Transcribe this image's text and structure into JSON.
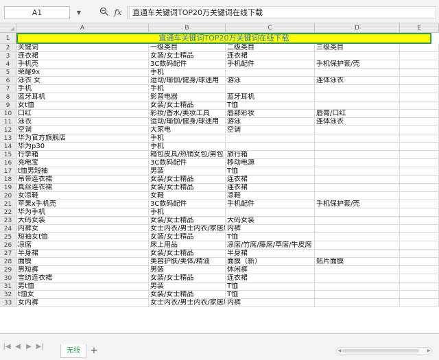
{
  "formula_bar": {
    "cell_ref": "A1",
    "dropdown_icon": "chevron-down-icon",
    "zoom_icon": "magnifier-icon",
    "fx_label": "fx",
    "content": "直通车关键词TOP20万关键词在线下载"
  },
  "columns": [
    "A",
    "B",
    "C",
    "D",
    "E"
  ],
  "title": "直通车关键词TOP20万关键词在线下载",
  "rows": [
    {
      "n": "1"
    },
    {
      "n": "2",
      "cells": [
        "关键词",
        "一级类目",
        "二级类目",
        "三级类目"
      ]
    },
    {
      "n": "3",
      "cells": [
        "连衣裙",
        "女装/女士精品",
        "连衣裙",
        ""
      ]
    },
    {
      "n": "4",
      "cells": [
        "手机壳",
        "3C数码配件",
        "手机配件",
        "手机保护套/壳"
      ]
    },
    {
      "n": "5",
      "cells": [
        "荣耀9x",
        "手机",
        "",
        ""
      ]
    },
    {
      "n": "6",
      "cells": [
        "泳衣 女",
        "运动/瑜伽/健身/球迷用",
        "游泳",
        "连体泳衣"
      ]
    },
    {
      "n": "7",
      "cells": [
        "手机",
        "手机",
        "",
        ""
      ]
    },
    {
      "n": "8",
      "cells": [
        "蓝牙耳机",
        "影音电器",
        "蓝牙耳机",
        ""
      ]
    },
    {
      "n": "9",
      "cells": [
        "女t恤",
        "女装/女士精品",
        "T恤",
        ""
      ]
    },
    {
      "n": "10",
      "cells": [
        "口红",
        "彩妆/香水/美妆工具",
        "唇部彩妆",
        "唇膏/口红"
      ]
    },
    {
      "n": "11",
      "cells": [
        "泳衣",
        "运动/瑜伽/健身/球迷用",
        "游泳",
        "连体泳衣"
      ]
    },
    {
      "n": "12",
      "cells": [
        "空调",
        "大家电",
        "空调",
        ""
      ]
    },
    {
      "n": "13",
      "cells": [
        "华为官方旗舰店",
        "手机",
        "",
        ""
      ]
    },
    {
      "n": "14",
      "cells": [
        "华为p30",
        "手机",
        "",
        ""
      ]
    },
    {
      "n": "15",
      "cells": [
        "行李箱",
        "箱包皮具/热销女包/男包",
        "旅行箱",
        ""
      ]
    },
    {
      "n": "16",
      "cells": [
        "充电宝",
        "3C数码配件",
        "移动电源",
        ""
      ]
    },
    {
      "n": "17",
      "cells": [
        "t恤男短袖",
        "男装",
        "T恤",
        ""
      ]
    },
    {
      "n": "18",
      "cells": [
        "吊带连衣裙",
        "女装/女士精品",
        "连衣裙",
        ""
      ]
    },
    {
      "n": "19",
      "cells": [
        "真丝连衣裙",
        "女装/女士精品",
        "连衣裙",
        ""
      ]
    },
    {
      "n": "20",
      "cells": [
        "女凉鞋",
        "女鞋",
        "凉鞋",
        ""
      ]
    },
    {
      "n": "21",
      "cells": [
        "苹果x手机壳",
        "3C数码配件",
        "手机配件",
        "手机保护套/壳"
      ]
    },
    {
      "n": "22",
      "cells": [
        "华为手机",
        "手机",
        "",
        ""
      ]
    },
    {
      "n": "23",
      "cells": [
        "大码女装",
        "女装/女士精品",
        "大码女装",
        ""
      ]
    },
    {
      "n": "24",
      "cells": [
        "内裤女",
        "女士内衣/男士内衣/家居服",
        "内裤",
        ""
      ]
    },
    {
      "n": "25",
      "cells": [
        "短袖女t恤",
        "女装/女士精品",
        "T恤",
        ""
      ]
    },
    {
      "n": "26",
      "cells": [
        "凉席",
        "床上用品",
        "凉席/竹席/藤席/草席/牛皮席",
        ""
      ]
    },
    {
      "n": "27",
      "cells": [
        "半身裙",
        "女装/女士精品",
        "半身裙",
        ""
      ]
    },
    {
      "n": "28",
      "cells": [
        "面膜",
        "美容护肤/美体/精油",
        "面膜（新）",
        "贴片面膜"
      ]
    },
    {
      "n": "29",
      "cells": [
        "男短裤",
        "男装",
        "休闲裤",
        ""
      ]
    },
    {
      "n": "30",
      "cells": [
        "雪纺连衣裙",
        "女装/女士精品",
        "连衣裙",
        ""
      ]
    },
    {
      "n": "31",
      "cells": [
        "男t恤",
        "男装",
        "T恤",
        ""
      ]
    },
    {
      "n": "32",
      "cells": [
        "t恤女",
        "女装/女士精品",
        "T恤",
        ""
      ]
    },
    {
      "n": "33",
      "cells": [
        "女内裤",
        "女士内衣/男士内衣/家居服",
        "内裤",
        ""
      ]
    }
  ],
  "sheet_tabs": [
    {
      "label": "无线",
      "active": true
    }
  ],
  "add_sheet_label": "+",
  "nav_icons": [
    "first-sheet-icon",
    "prev-sheet-icon",
    "next-sheet-icon",
    "last-sheet-icon"
  ],
  "colors": {
    "title_fill": "#ffff00",
    "title_border": "#2f9a44",
    "title_text": "#2a7fb8",
    "active_tab_text": "#2aa24a"
  }
}
